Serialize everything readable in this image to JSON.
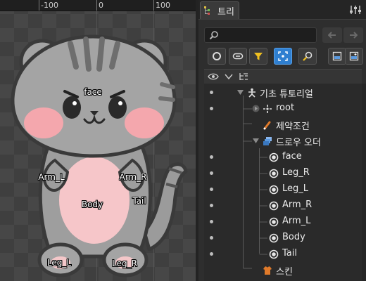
{
  "ruler": {
    "labels": [
      "-100",
      "0",
      "100"
    ]
  },
  "bones": [
    "face",
    "Arm_L",
    "Arm_R",
    "Tail",
    "Body",
    "Leg_L",
    "Leg_R"
  ],
  "panel": {
    "tab_label": "트리",
    "search": {
      "value": "",
      "placeholder": ""
    },
    "tree": {
      "root": "기초 튜토리얼",
      "items": [
        "root",
        "제약조건",
        "드로우 오더",
        "face",
        "Leg_R",
        "Leg_L",
        "Arm_R",
        "Arm_L",
        "Body",
        "Tail",
        "스킨"
      ]
    }
  },
  "colors": {
    "accent": "#2f7fd0",
    "filter": "#f0c020",
    "constraint": "#e07a2a",
    "draw_order": "#5a9ae0",
    "skin": "#e07a2a"
  }
}
